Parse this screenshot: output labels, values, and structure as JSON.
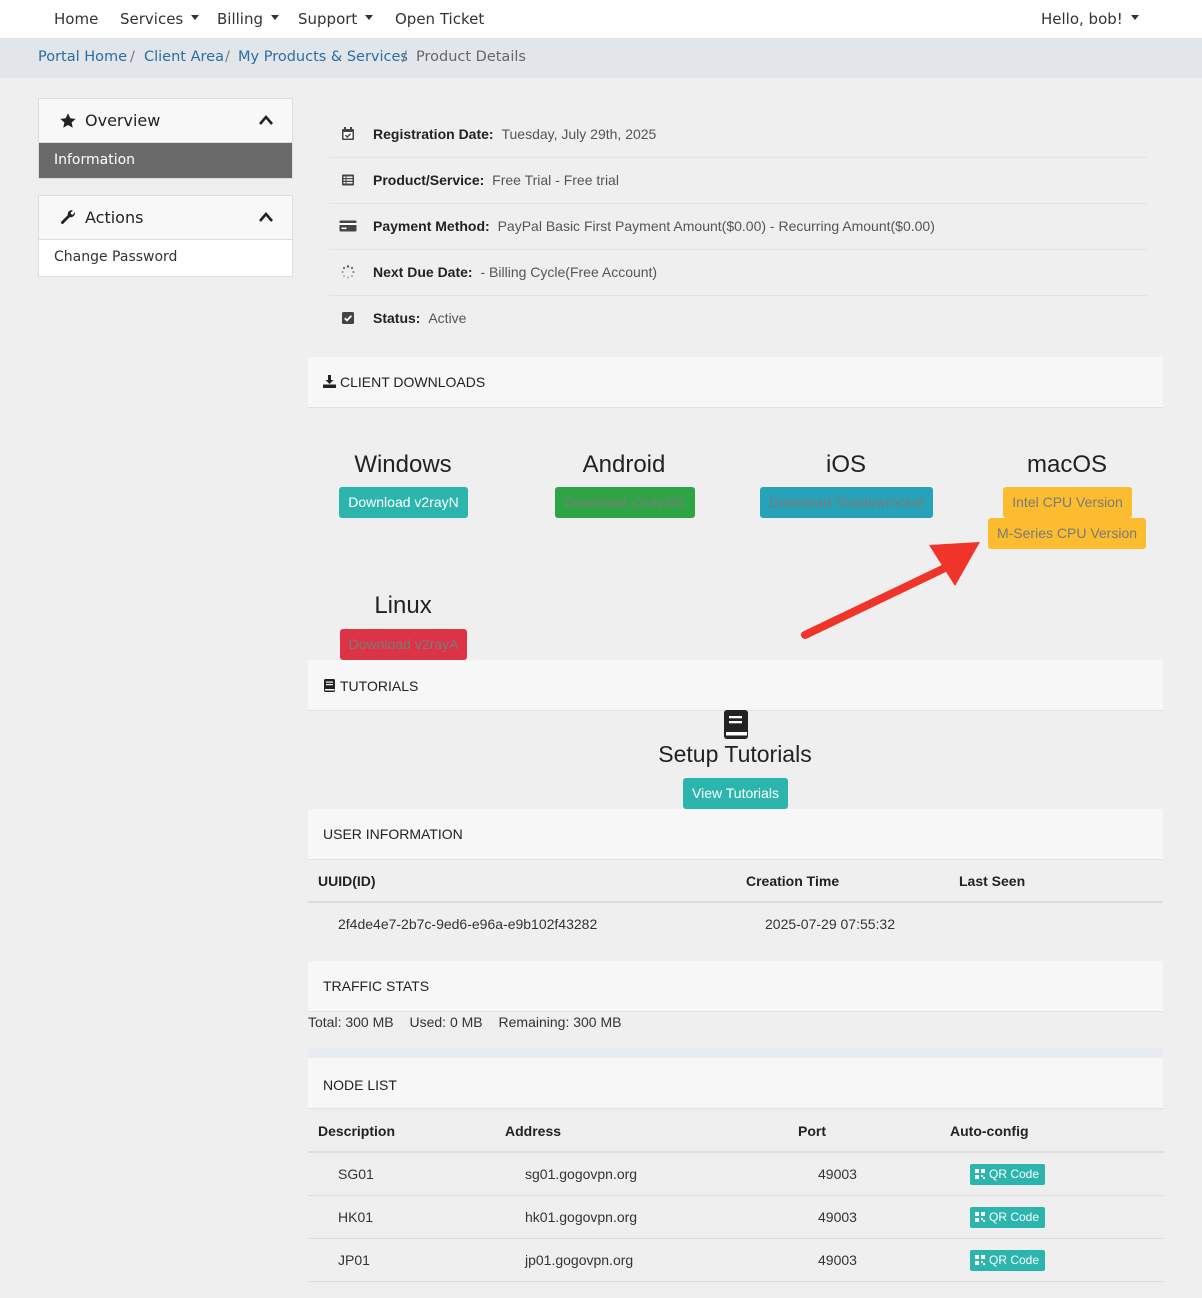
{
  "nav": {
    "home": "Home",
    "services": "Services",
    "billing": "Billing",
    "support": "Support",
    "open_ticket": "Open Ticket",
    "user": "Hello, bob!"
  },
  "breadcrumb": {
    "portal_home": "Portal Home",
    "client_area": "Client Area",
    "products": "My Products & Services",
    "current": "Product Details",
    "separator": "/"
  },
  "sidebar": {
    "overview_title": "Overview",
    "information": "Information",
    "actions_title": "Actions",
    "change_password": "Change Password"
  },
  "details": {
    "registration_label": "Registration Date:",
    "registration_value": "Tuesday, July 29th, 2025",
    "product_label": "Product/Service:",
    "product_value": "Free Trial - Free trial",
    "payment_label": "Payment Method:",
    "payment_value": "PayPal Basic First Payment Amount($0.00) - Recurring Amount($0.00)",
    "due_label": "Next Due Date:",
    "due_value": "- Billing Cycle(Free Account)",
    "status_label": "Status:",
    "status_value": "Active"
  },
  "downloads": {
    "heading": "CLIENT DOWNLOADS",
    "windows_title": "Windows",
    "windows_button": "Download v2rayN",
    "android_title": "Android",
    "android_button": "Download v2rayNG",
    "ios_title": "iOS",
    "ios_button": "Download Shadowrocket",
    "macos_title": "macOS",
    "macos_intel_button": "Intel CPU Version",
    "macos_m_button": "M-Series CPU Version",
    "linux_title": "Linux",
    "linux_button": "Download v2rayA"
  },
  "tutorials": {
    "heading": "TUTORIALS",
    "title": "Setup Tutorials",
    "button": "View Tutorials"
  },
  "user_info": {
    "heading": "USER INFORMATION",
    "columns": [
      "UUID(ID)",
      "Creation Time",
      "Last Seen"
    ],
    "row": {
      "uuid": "2f4de4e7-2b7c-9ed6-e96a-e9b102f43282",
      "created": "2025-07-29 07:55:32",
      "last_seen": ""
    }
  },
  "traffic": {
    "heading": "TRAFFIC STATS",
    "total": "Total: 300 MB",
    "used": "Used: 0 MB",
    "remaining": "Remaining: 300 MB"
  },
  "nodes": {
    "heading": "NODE LIST",
    "columns": [
      "Description",
      "Address",
      "Port",
      "Auto-config"
    ],
    "qr_label": "QR Code",
    "rows": [
      {
        "description": "SG01",
        "address": "sg01.gogovpn.org",
        "port": "49003"
      },
      {
        "description": "HK01",
        "address": "hk01.gogovpn.org",
        "port": "49003"
      },
      {
        "description": "JP01",
        "address": "jp01.gogovpn.org",
        "port": "49003"
      }
    ]
  },
  "colors": {
    "teal": "#2cb5ad",
    "green": "#2ea544",
    "cyan": "#26a3b8",
    "yellow": "#fbbc2f",
    "red": "#dd3346",
    "arrow": "#f0342a",
    "link": "#2a6ea3"
  },
  "icons": {
    "registration": "calendar-check-icon",
    "product": "list-icon",
    "payment": "credit-card-icon",
    "due": "spinner-icon",
    "status": "check-square-icon",
    "downloads": "download-icon",
    "tutorials": "book-icon",
    "overview": "star-icon",
    "actions": "wrench-icon"
  }
}
